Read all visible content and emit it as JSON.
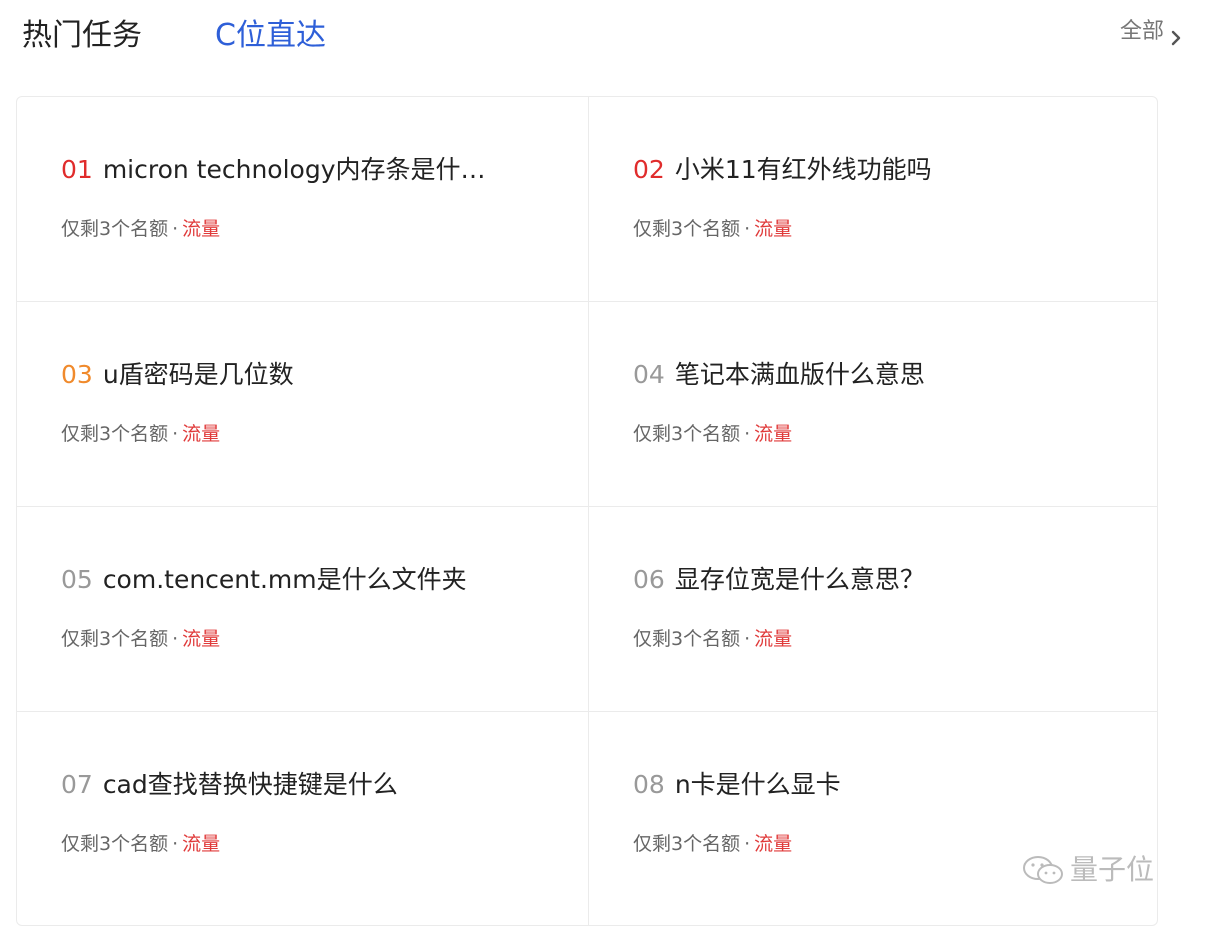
{
  "header": {
    "tabs": [
      {
        "label": "热门任务"
      },
      {
        "label": "C位直达"
      }
    ],
    "all_label": "全部"
  },
  "colors": {
    "num_red": "#e02c2c",
    "num_orange": "#f08a2c",
    "num_gray": "#999999",
    "tab_active": "#2e5fd8",
    "meta_tag": "#e03a3a"
  },
  "tasks": [
    {
      "num": "01",
      "num_color": "red",
      "title": "micron technology内存条是什…",
      "meta_prefix": "仅剩3个名额",
      "meta_sep": "·",
      "meta_tag": "流量"
    },
    {
      "num": "02",
      "num_color": "red",
      "title": "小米11有红外线功能吗",
      "meta_prefix": "仅剩3个名额",
      "meta_sep": "·",
      "meta_tag": "流量"
    },
    {
      "num": "03",
      "num_color": "orange",
      "title": "u盾密码是几位数",
      "meta_prefix": "仅剩3个名额",
      "meta_sep": "·",
      "meta_tag": "流量"
    },
    {
      "num": "04",
      "num_color": "gray",
      "title": "笔记本满血版什么意思",
      "meta_prefix": "仅剩3个名额",
      "meta_sep": "·",
      "meta_tag": "流量"
    },
    {
      "num": "05",
      "num_color": "gray",
      "title": "com.tencent.mm是什么文件夹",
      "meta_prefix": "仅剩3个名额",
      "meta_sep": "·",
      "meta_tag": "流量"
    },
    {
      "num": "06",
      "num_color": "gray",
      "title": "显存位宽是什么意思？",
      "meta_prefix": "仅剩3个名额",
      "meta_sep": "·",
      "meta_tag": "流量"
    },
    {
      "num": "07",
      "num_color": "gray",
      "title": "cad查找替换快捷键是什么",
      "meta_prefix": "仅剩3个名额",
      "meta_sep": "·",
      "meta_tag": "流量"
    },
    {
      "num": "08",
      "num_color": "gray",
      "title": "n卡是什么显卡",
      "meta_prefix": "仅剩3个名额",
      "meta_sep": "·",
      "meta_tag": "流量"
    }
  ],
  "watermark": {
    "text": "量子位",
    "icon": "wechat-icon"
  }
}
